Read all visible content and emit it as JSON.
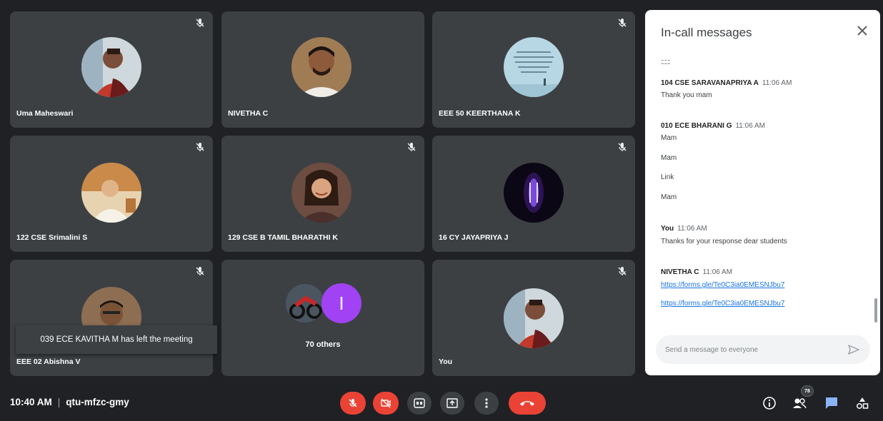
{
  "participants": [
    {
      "name": "Uma Maheswari"
    },
    {
      "name": "NIVETHA C"
    },
    {
      "name": "EEE 50 KEERTHANA K"
    },
    {
      "name": "122 CSE Srimalini S"
    },
    {
      "name": "129 CSE B TAMIL BHARATHI K"
    },
    {
      "name": "16 CY JAYAPRIYA J"
    },
    {
      "name": "EEE 02 Abishna V"
    },
    {
      "name": "70 others",
      "initial": "I"
    },
    {
      "name": "You"
    }
  ],
  "toast": "039 ECE KAVITHA M has left the meeting",
  "chat": {
    "title": "In-call messages",
    "cut_text": "ﾆﾆﾆ",
    "messages": [
      {
        "sender": "104 CSE SARAVANAPRIYA A",
        "time": "11:06 AM",
        "lines": [
          "Thank you mam"
        ]
      },
      {
        "sender": "010 ECE BHARANI G",
        "time": "11:06 AM",
        "lines": [
          "Mam",
          "Mam",
          "Link",
          "Mam"
        ]
      },
      {
        "sender": "You",
        "time": "11:06 AM",
        "lines": [
          "Thanks for your response dear students"
        ]
      },
      {
        "sender": "NIVETHA C",
        "time": "11:06 AM",
        "links": [
          "https://forms.gle/Te0C3ia0EMESNJbu7",
          "https://forms.gle/Te0C3ia0EMESNJbu7"
        ]
      }
    ],
    "input_placeholder": "Send a message to everyone"
  },
  "bottom_bar": {
    "time": "10:40 AM",
    "separator": "|",
    "meeting_code": "qtu-mfzc-gmy",
    "people_count": "78"
  },
  "icons": [
    "mic-off-icon",
    "camera-off-icon",
    "captions-icon",
    "present-icon",
    "more-options-icon",
    "end-call-icon",
    "info-icon",
    "people-icon",
    "chat-icon",
    "activities-icon",
    "close-icon",
    "send-icon"
  ],
  "colors": {
    "background": "#202124",
    "tile": "#3c4043",
    "danger": "#ea4335",
    "accent": "#1a73e8",
    "avatar_purple": "#a142f4"
  }
}
